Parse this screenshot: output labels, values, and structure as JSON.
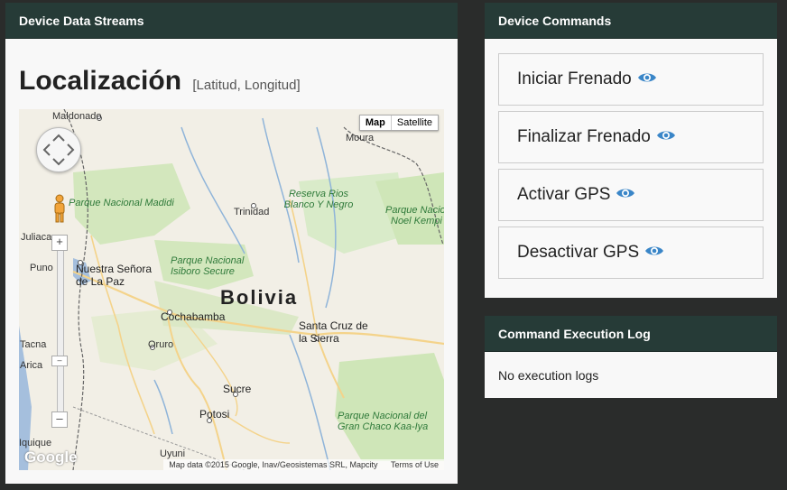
{
  "streams": {
    "header": "Device Data Streams",
    "title": "Localización",
    "subtitle": "[Latitud, Longitud]",
    "map": {
      "type_map": "Map",
      "type_satellite": "Satellite",
      "attribution": "Map data ©2015 Google, Inav/Geosistemas SRL, Mapcity",
      "terms": "Terms of Use",
      "logo": "Google",
      "labels": {
        "maldonado": "Maldonado",
        "moura": "Moura",
        "madidi": "Parque Nacional Madidi",
        "reserva": "Reserva Rios Blanco Y Negro",
        "trinidad": "Trinidad",
        "noel_a": "Parque Nacional",
        "noel_b": "Noel Kempi",
        "juliaca": "Juliaca",
        "puno": "Puno",
        "nuestra": "Nuestra Señora de La Paz",
        "isiboro": "Parque Nacional Isiboro Secure",
        "bolivia": "Bolivia",
        "cochabamba": "Cochabamba",
        "santa_cruz": "Santa Cruz de la Sierra",
        "tacna": "Tacna",
        "oruro": "Oruro",
        "arica": "Arica",
        "sucre": "Sucre",
        "potosi": "Potosi",
        "chaco_a": "Parque Nacional del",
        "chaco_b": "Gran Chaco Kaa-Iya",
        "iquique": "Iquique",
        "uyuni": "Uyuni"
      }
    }
  },
  "commands": {
    "header": "Device Commands",
    "items": [
      {
        "label": "Iniciar Frenado"
      },
      {
        "label": "Finalizar Frenado"
      },
      {
        "label": "Activar GPS"
      },
      {
        "label": "Desactivar GPS"
      }
    ]
  },
  "log": {
    "header": "Command Execution Log",
    "empty": "No execution logs"
  },
  "colors": {
    "header_bg": "#263b37",
    "eye": "#3a86c8",
    "park": "#cfe6b8"
  },
  "icons": [
    "eye-icon",
    "pan-control-icon",
    "pegman-icon"
  ]
}
